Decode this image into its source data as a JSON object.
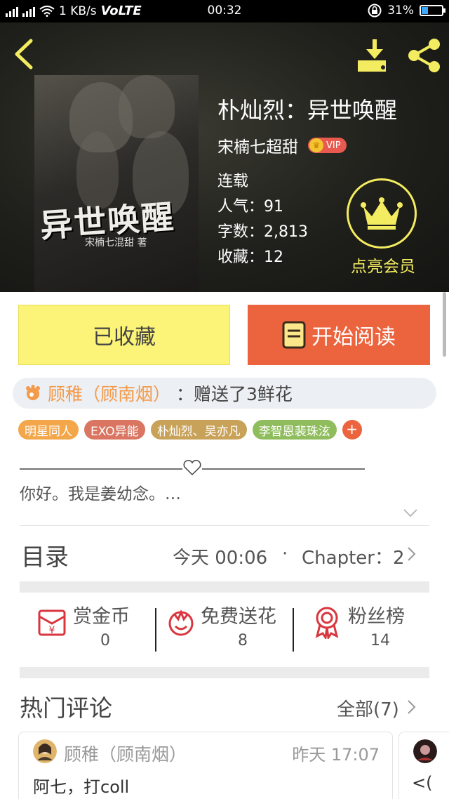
{
  "status_bar": {
    "network": "3G 4G",
    "speed": "1 KB/s",
    "volte": "VoLTE",
    "time": "00:32",
    "battery": "31%",
    "battery_level": 0.31
  },
  "book": {
    "title": "朴灿烈：异世唤醒",
    "author": "宋楠七超甜",
    "vip_label": "VIP",
    "status": "连载",
    "popularity": "人气：91",
    "word_count": "字数：2,813",
    "favorites": "收藏：12",
    "member_label": "点亮会员",
    "cover": {
      "title": "异世唤醒",
      "author": "宋楠七混甜 著"
    }
  },
  "actions": {
    "collected_label": "已收藏",
    "read_label": "开始阅读"
  },
  "gift": {
    "giver": "顾稚（顾南烟）",
    "text": "：赠送了3鲜花"
  },
  "tags": [
    {
      "label": "明星同人",
      "color": "#f3a64a"
    },
    {
      "label": "EXO异能",
      "color": "#d97561"
    },
    {
      "label": "朴灿烈、吴亦凡",
      "color": "#c9a25a"
    },
    {
      "label": "李智恩裴珠泫",
      "color": "#8fbd5d"
    }
  ],
  "tag_add_label": "+",
  "intro": "你好。我是姜幼念。…",
  "toc": {
    "label": "目录",
    "updated": "今天 00:06",
    "separator": "·",
    "chapter": "Chapter：2"
  },
  "stats": {
    "reward": {
      "label": "赏金币",
      "value": "0"
    },
    "flowers": {
      "label": "免费送花",
      "value": "8"
    },
    "fans": {
      "label": "粉丝榜",
      "value": "14"
    }
  },
  "hot_comments": {
    "title": "热门评论",
    "all_label": "全部(7)",
    "items": [
      {
        "user": "顾稚（顾南烟）",
        "time": "昨天 17:07",
        "text": "阿七，打coll"
      },
      {
        "user": "",
        "time": "",
        "text": "<("
      }
    ]
  },
  "colors": {
    "accent_orange": "#ec643d",
    "collected_yellow": "#fcf379",
    "member_yellow": "#f4ec60",
    "icon_red": "#d9363e"
  }
}
